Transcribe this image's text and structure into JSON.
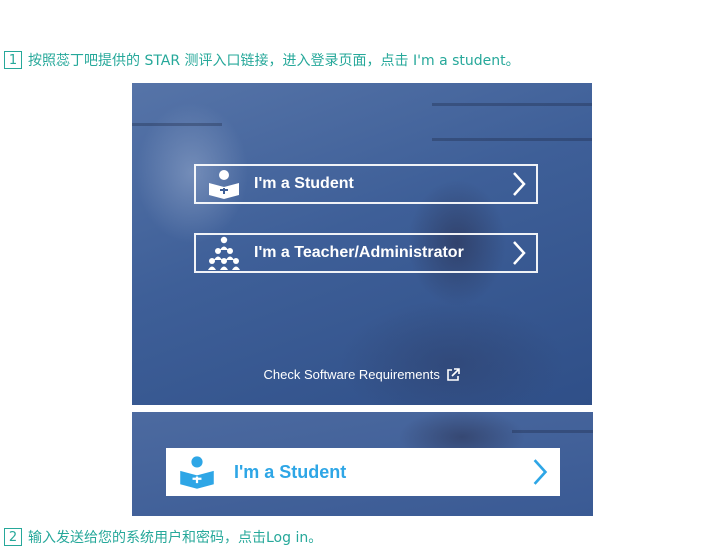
{
  "steps": [
    {
      "num": "1",
      "text": "按照蕊丁吧提供的 STAR 测评入口链接，进入登录页面，点击 I'm a student。"
    },
    {
      "num": "2",
      "text": "输入发送给您的系统用户和密码，点击Log in。"
    }
  ],
  "login_panel": {
    "buttons": [
      {
        "label": "I'm a Student",
        "icon": "student-reading-icon"
      },
      {
        "label": "I'm a Teacher/Administrator",
        "icon": "group-of-people-icon"
      }
    ],
    "requirements_link": "Check Software Requirements",
    "requirements_icon": "external-link-icon"
  },
  "hover_panel": {
    "button_label": "I'm a Student",
    "icon": "student-reading-icon",
    "accent_color": "#2ea6e6"
  },
  "colors": {
    "step_text": "#26a89a",
    "panel_blue": "#3e5f98"
  }
}
